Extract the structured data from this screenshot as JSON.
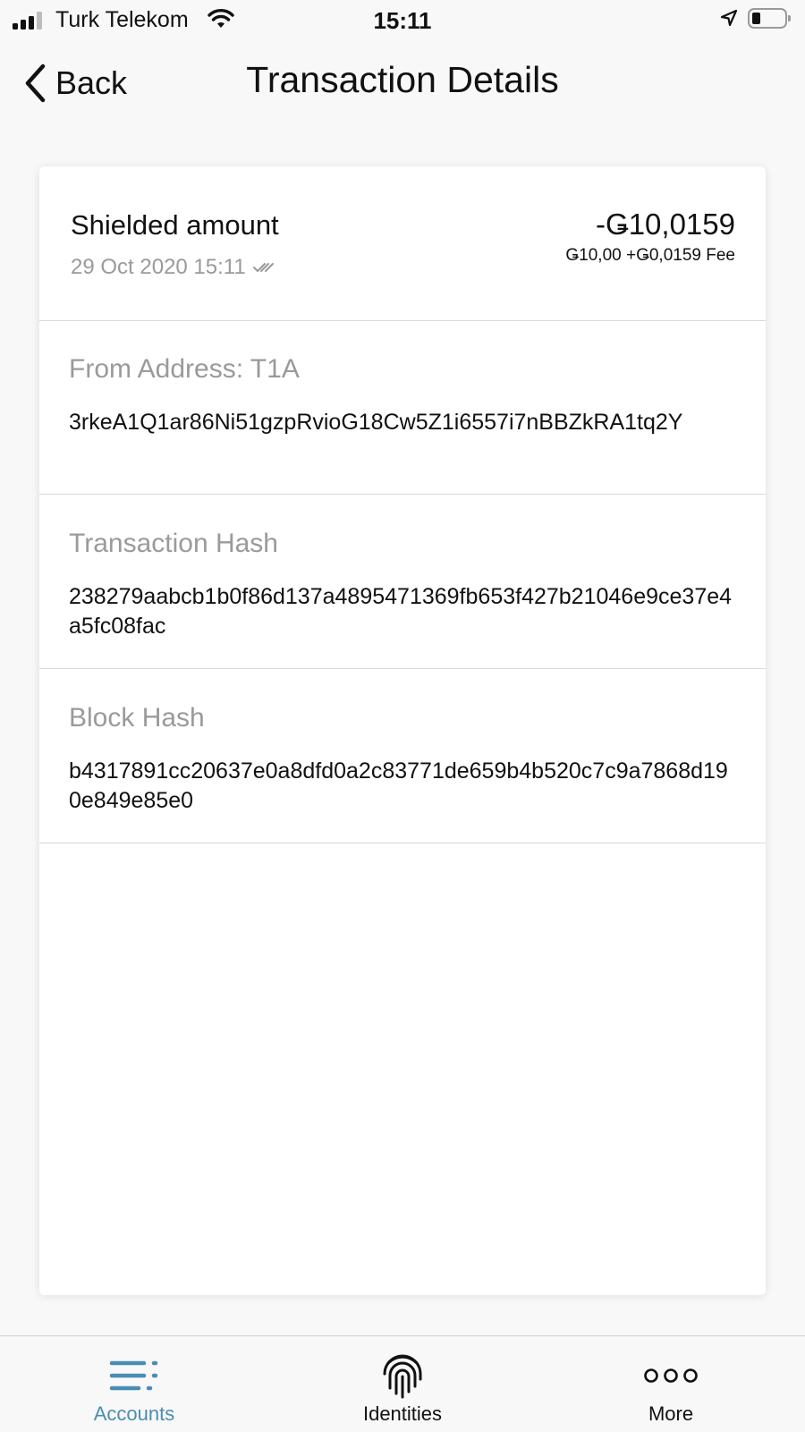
{
  "status_bar": {
    "carrier": "Turk Telekom",
    "time": "15:11",
    "battery_level": 0.25
  },
  "nav": {
    "back_label": "Back",
    "title": "Transaction Details"
  },
  "summary": {
    "title": "Shielded amount",
    "date": "29 Oct 2020 15:11",
    "amount": "-Ǥ10,0159",
    "fee_breakdown": "Ǥ10,00 +Ǥ0,0159 Fee"
  },
  "details": {
    "from_label": "From Address: T1A",
    "from_value": "3rkeA1Q1ar86Ni51gzpRvioG18Cw5Z1i6557i7nBBZkRA1tq2Y",
    "tx_hash_label": "Transaction Hash",
    "tx_hash_value": "238279aabcb1b0f86d137a4895471369fb653f427b21046e9ce37e4a5fc08fac",
    "block_hash_label": "Block Hash",
    "block_hash_value": "b4317891cc20637e0a8dfd0a2c83771de659b4b520c7c9a7868d190e849e85e0"
  },
  "tab_bar": {
    "tabs": [
      {
        "label": "Accounts",
        "icon": "list-icon",
        "active": true
      },
      {
        "label": "Identities",
        "icon": "fingerprint-icon",
        "active": false
      },
      {
        "label": "More",
        "icon": "more-dots-icon",
        "active": false
      }
    ]
  },
  "colors": {
    "accent": "#4a8db3",
    "secondary_text": "#9a9a9a",
    "primary_text": "#111111",
    "background": "#f8f8f8",
    "card": "#ffffff"
  }
}
